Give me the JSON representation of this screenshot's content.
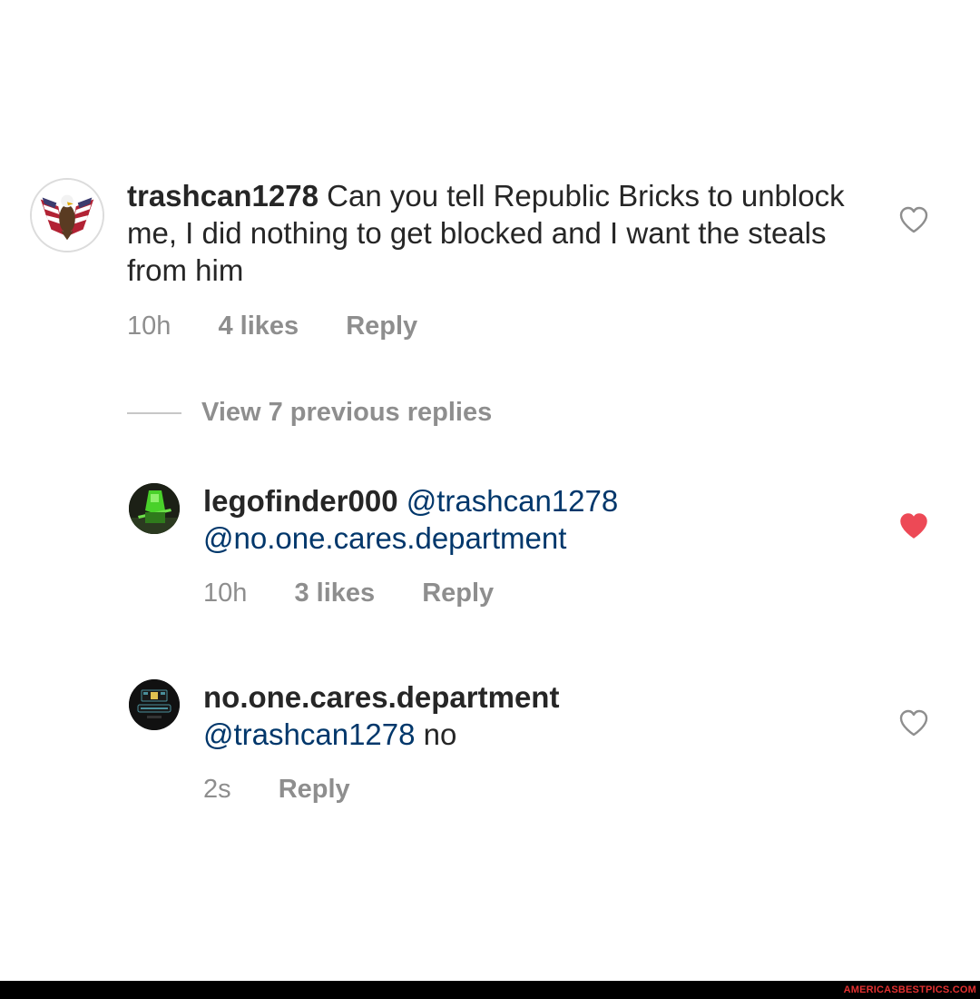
{
  "comments": [
    {
      "username": "trashcan1278",
      "body": "Can you tell Republic Bricks to unblock me, I did nothing to get blocked and I want the steals from him",
      "mentions": [],
      "time": "10h",
      "likes": "4 likes",
      "reply": "Reply",
      "liked": false,
      "avatar_icon": "eagle-flag-avatar"
    },
    {
      "username": "legofinder000",
      "body": "",
      "mentions": [
        "@trashcan1278",
        "@no.one.cares.department"
      ],
      "time": "10h",
      "likes": "3 likes",
      "reply": "Reply",
      "liked": true,
      "avatar_icon": "lego-figure-avatar"
    },
    {
      "username": "no.one.cares.department",
      "body": "no",
      "mentions": [
        "@trashcan1278"
      ],
      "time": "2s",
      "reply": "Reply",
      "liked": false,
      "avatar_icon": "department-logo-avatar"
    }
  ],
  "view_replies": "View 7 previous replies",
  "watermark": "AMERICASBESTPICS.COM",
  "colors": {
    "text": "#262626",
    "meta": "#8e8e8e",
    "mention": "#00376b",
    "heart_liked": "#ed4956",
    "heart_outline": "#8e8e8e",
    "watermark": "#e53030"
  }
}
